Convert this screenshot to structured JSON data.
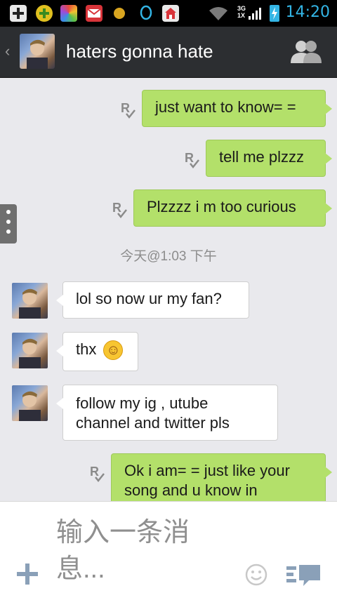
{
  "status_bar": {
    "time": "14:20",
    "network_labels": [
      "3G",
      "1X"
    ],
    "icons": [
      "add-icon",
      "game-icon",
      "photo-app-icon",
      "mail-icon",
      "coin-icon",
      "qq-icon",
      "home-icon",
      "wifi-icon",
      "signal-icon",
      "battery-charging-icon"
    ]
  },
  "header": {
    "title": "haters gonna hate",
    "back_icon": "chevron-left-icon",
    "contacts_icon": "contacts-icon"
  },
  "messages": [
    {
      "dir": "out",
      "text": "just want to know= ="
    },
    {
      "dir": "out",
      "text": "tell me plzzz"
    },
    {
      "dir": "out",
      "text": "Plzzzz i m too curious"
    },
    {
      "dir": "in",
      "text": "lol so now ur my fan?"
    },
    {
      "dir": "in",
      "text": "thx",
      "emoji": "☺"
    },
    {
      "dir": "in",
      "text_lines": [
        "follow my ig , utube",
        "channel and twitter pls"
      ]
    },
    {
      "dir": "out",
      "text_lines": [
        "Ok i am= = just like your",
        "song    and u know in"
      ]
    }
  ],
  "timestamp": "今天@1:03 下午",
  "input": {
    "placeholder_lines": [
      "输入一条消",
      "息..."
    ]
  },
  "colors": {
    "outgoing_bubble": "#b3e06a",
    "incoming_bubble": "#ffffff",
    "header_bg": "#2c2e31",
    "status_accent": "#33b5e5"
  }
}
